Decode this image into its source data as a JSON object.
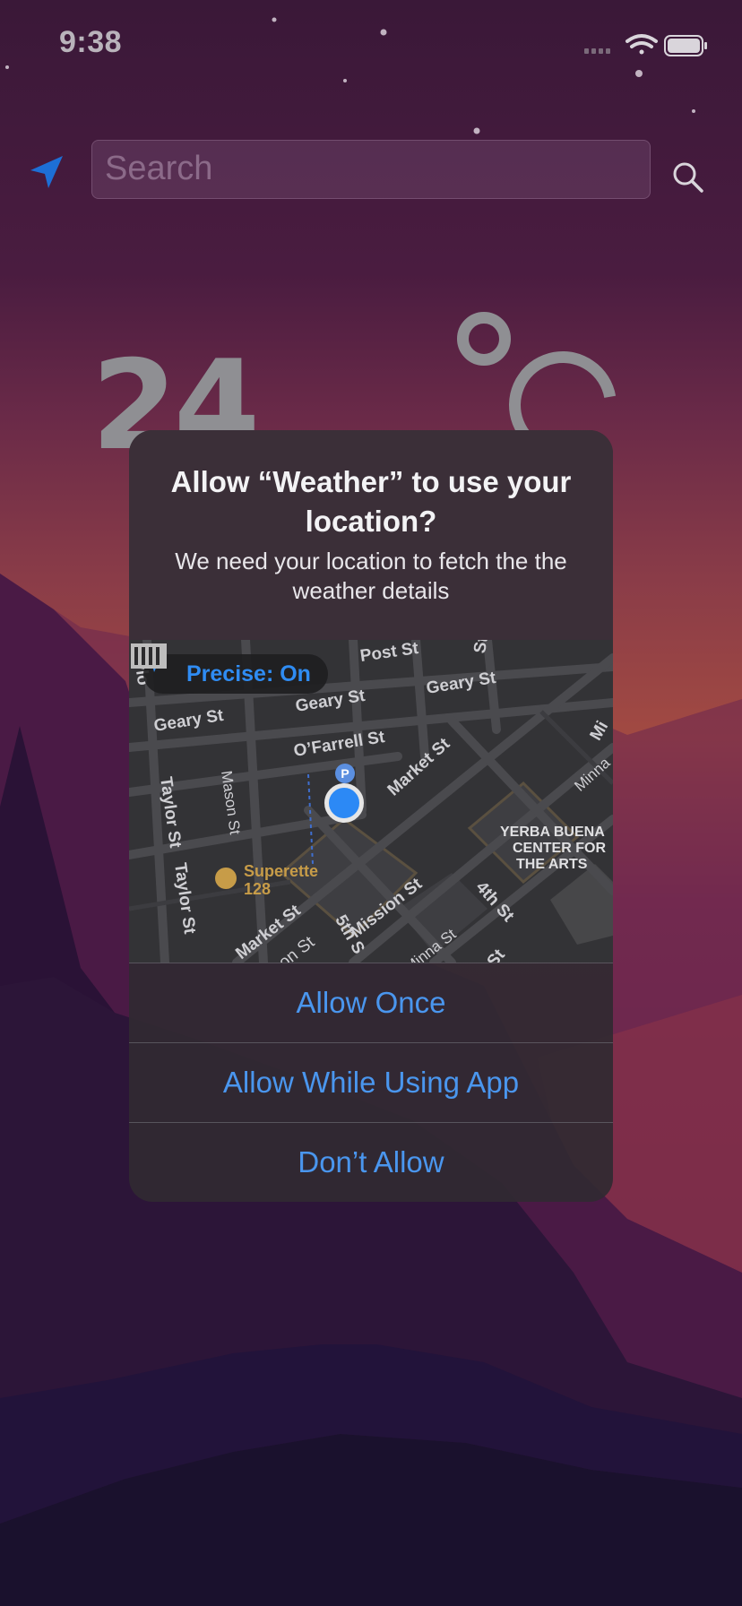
{
  "status_bar": {
    "time": "9:38"
  },
  "search": {
    "placeholder": "Search"
  },
  "weather": {
    "temperature": "24"
  },
  "alert": {
    "title": "Allow “Weather” to use your location?",
    "message": "We need your location to fetch the the weather details",
    "precise_label": "Precise: On",
    "buttons": {
      "allow_once": "Allow Once",
      "allow_while_using": "Allow While Using App",
      "dont_allow": "Don’t Allow"
    }
  },
  "map": {
    "streets": {
      "post": "Post St",
      "geary_left": "Geary St",
      "geary_mid": "Geary St",
      "geary_right": "Geary St",
      "ofarrell": "O’Farrell St",
      "market_top": "Market St",
      "market_bottom": "Market St",
      "mason": "Mason St",
      "taylor_top": "Taylor St",
      "taylor_bottom": "Taylor St",
      "mission": "Mission St",
      "minna": "Minna St",
      "fourth": "4th St",
      "fifth": "5th S",
      "minna_right": "Minna",
      "mi": "Mi",
      "jones": "Jones St",
      "ayl": "aylo",
      "st_top": "St",
      "st_bottom": "St",
      "on_st": "on St"
    },
    "poi": {
      "superette_line1": "Superette",
      "superette_line2": "128",
      "yerba_line1": "YERBA BUENA",
      "yerba_line2": "CENTER FOR",
      "yerba_line3": "THE ARTS",
      "parking": "P"
    }
  },
  "colors": {
    "accent": "#4a96ee",
    "precise_blue": "#2f8cf3",
    "location_pin": "#2c89f5"
  }
}
